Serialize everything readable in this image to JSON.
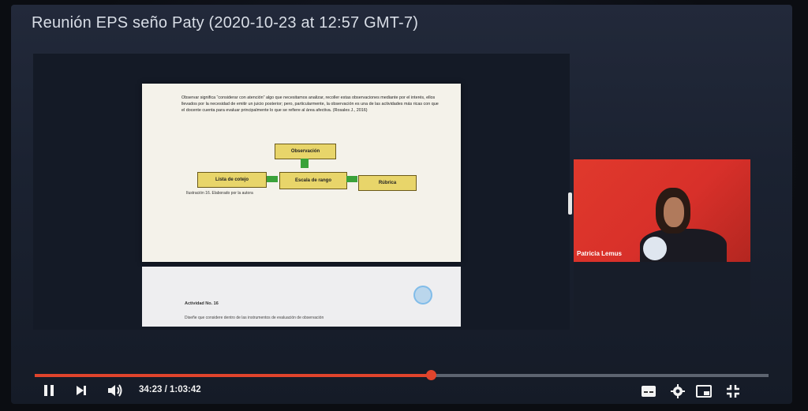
{
  "player": {
    "title": "Reunión EPS seño Paty (2020-10-23 at 12:57 GMT-7)",
    "time_current": "34:23",
    "time_total": "1:03:42",
    "time_display": "34:23 / 1:03:42",
    "progress_fraction": 0.54,
    "accent_color": "#e0442c"
  },
  "slide": {
    "paragraph": "Observar significa “considerar con atención” algo que necesitamos analizar, recoller estas observaciones mediante por el interés, ellos llevados por la necesidad de emitir un juicio posterior; pero, particularmente, la observación es una de las actividades más ricas con que el docente cuenta para evaluar principalmente lo que se refiere al área afectiva. (Rosales J., 2016)",
    "boxes": [
      "Observación",
      "Lista de cotejo",
      "Escala de rango",
      "Rúbrica"
    ],
    "caption": "Ilustración 16. Elaborado por la autora",
    "activity": "Actividad No. 16",
    "activity_text": "Diseñe que considere dentro de las instrumentos de evaluación de observación"
  },
  "webcam": {
    "participant_name": "Patricia Lemus"
  },
  "icons": {
    "pause": "pause-icon",
    "next": "next-icon",
    "volume": "volume-icon",
    "subtitles": "subtitles-icon",
    "settings": "gear-icon",
    "miniplayer": "miniplayer-icon",
    "exit_fullscreen": "exit-fullscreen-icon"
  }
}
